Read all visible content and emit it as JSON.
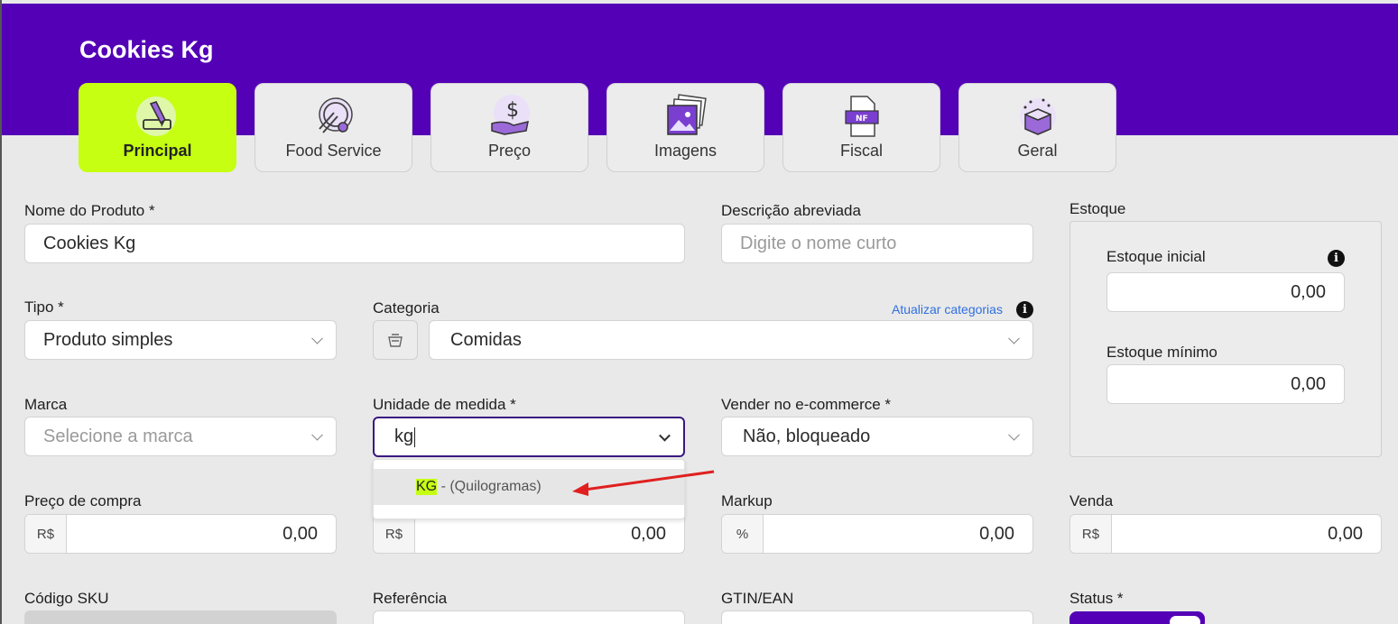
{
  "header": {
    "title": "Cookies Kg"
  },
  "tabs": [
    {
      "label": "Principal",
      "icon": "pencil-edit-icon",
      "active": true
    },
    {
      "label": "Food Service",
      "icon": "plate-fork-gear-icon"
    },
    {
      "label": "Preço",
      "icon": "hand-dollar-icon"
    },
    {
      "label": "Imagens",
      "icon": "images-stack-icon"
    },
    {
      "label": "Fiscal",
      "icon": "nf-document-icon"
    },
    {
      "label": "Geral",
      "icon": "gift-box-icon"
    }
  ],
  "form": {
    "nome": {
      "label": "Nome do Produto *",
      "value": "Cookies Kg"
    },
    "descricao": {
      "label": "Descrição abreviada",
      "placeholder": "Digite o nome curto"
    },
    "tipo": {
      "label": "Tipo *",
      "value": "Produto simples"
    },
    "categoria": {
      "label": "Categoria",
      "value": "Comidas",
      "link": "Atualizar categorias"
    },
    "marca": {
      "label": "Marca",
      "placeholder": "Selecione a marca"
    },
    "unidade": {
      "label": "Unidade de medida *",
      "value": "kg"
    },
    "ecommerce": {
      "label": "Vender no e-commerce *",
      "value": "Não, bloqueado"
    },
    "preco_compra": {
      "label": "Preço de compra",
      "prefix": "R$",
      "value": "0,00"
    },
    "custo": {
      "prefix": "R$",
      "value": "0,00"
    },
    "markup": {
      "label": "Markup",
      "prefix": "%",
      "value": "0,00"
    },
    "venda": {
      "label": "Venda",
      "prefix": "R$",
      "value": "0,00"
    },
    "sku": {
      "label": "Código SKU"
    },
    "referencia": {
      "label": "Referência"
    },
    "gtin": {
      "label": "GTIN/EAN"
    },
    "status": {
      "label": "Status *"
    }
  },
  "estoque": {
    "title": "Estoque",
    "inicial": {
      "label": "Estoque inicial",
      "value": "0,00"
    },
    "minimo": {
      "label": "Estoque mínimo",
      "value": "0,00"
    }
  },
  "dropdown": {
    "items": [
      {
        "match": "KG",
        "rest": " - (Quilogramas)"
      }
    ]
  },
  "colors": {
    "brand": "#5300b6",
    "accent": "#c6ff12",
    "arrow": "#e02020"
  }
}
